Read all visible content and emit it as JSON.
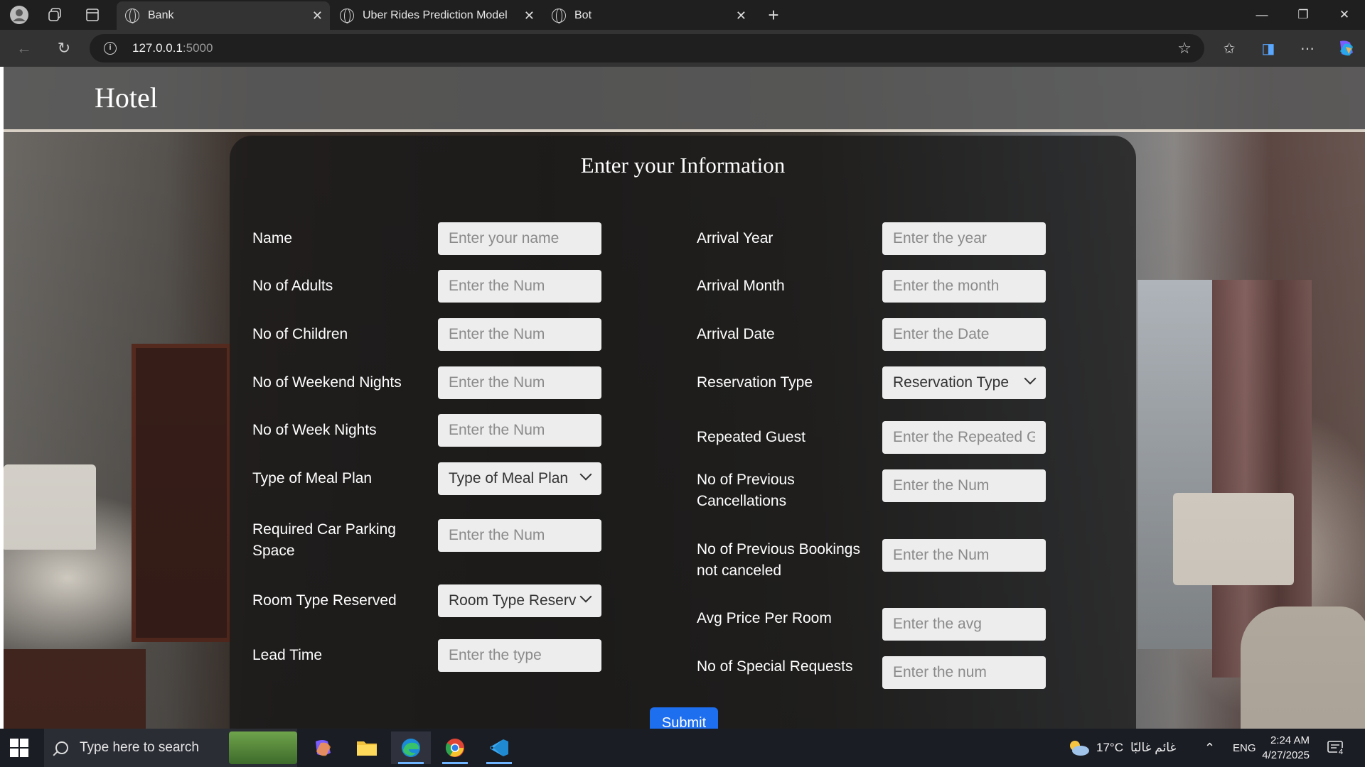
{
  "browser": {
    "tabs": [
      {
        "label": "Bank",
        "active": true
      },
      {
        "label": "Uber Rides Prediction Model",
        "active": false
      },
      {
        "label": "Bot",
        "active": false
      }
    ],
    "url_host": "127.0.0.1",
    "url_port": ":5000"
  },
  "page": {
    "brand": "Hotel",
    "form_title": "Enter your Information",
    "submit_label": "Submit",
    "left_fields": [
      {
        "label": "Name",
        "placeholder": "Enter your name"
      },
      {
        "label": "No of Adults",
        "placeholder": "Enter the Num"
      },
      {
        "label": "No of Children",
        "placeholder": "Enter the Num"
      },
      {
        "label": "No of Weekend Nights",
        "placeholder": "Enter the Num"
      },
      {
        "label": "No of Week Nights",
        "placeholder": "Enter the Num"
      },
      {
        "label": "Type of Meal Plan",
        "select_value": "Type of Meal Plan"
      },
      {
        "label": "Required Car Parking Space",
        "placeholder": "Enter the Num"
      },
      {
        "label": "Room Type Reserved",
        "select_value": "Room Type Reserved"
      },
      {
        "label": "Lead Time",
        "placeholder": "Enter the type"
      }
    ],
    "right_fields": [
      {
        "label": "Arrival Year",
        "placeholder": "Enter the year"
      },
      {
        "label": "Arrival Month",
        "placeholder": "Enter the month"
      },
      {
        "label": "Arrival Date",
        "placeholder": "Enter the Date"
      },
      {
        "label": "Reservation Type",
        "select_value": "Reservation Type"
      },
      {
        "label": "Repeated Guest",
        "placeholder": "Enter the Repeated Guest"
      },
      {
        "label": "No of Previous Cancellations",
        "placeholder": "Enter the Num"
      },
      {
        "label": "No of Previous Bookings not canceled",
        "placeholder": "Enter the Num"
      },
      {
        "label": "Avg Price Per Room",
        "placeholder": "Enter the avg"
      },
      {
        "label": "No of Special Requests",
        "placeholder": "Enter the num"
      }
    ]
  },
  "taskbar": {
    "search_placeholder": "Type here to search",
    "weather": "17°C",
    "weather_text": "غائم غالبًا",
    "language": "ENG",
    "time": "2:24 AM",
    "date": "4/27/2025",
    "notification_count": "4"
  }
}
